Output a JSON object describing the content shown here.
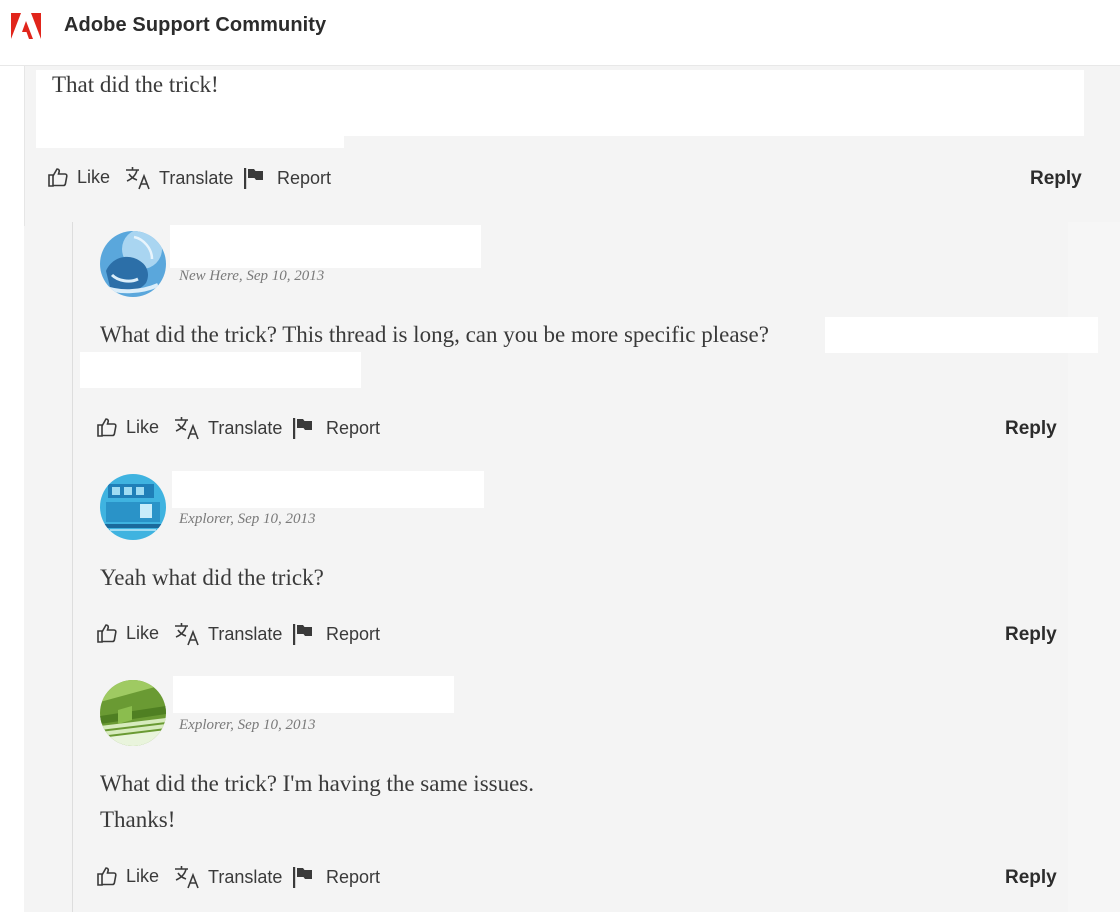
{
  "header": {
    "title": "Adobe Support Community",
    "logo_icon": "adobe-logo-icon",
    "brand_color": "#e1251b"
  },
  "actions": {
    "like": "Like",
    "translate": "Translate",
    "report": "Report",
    "reply": "Reply"
  },
  "posts": [
    {
      "body_lines": [
        "That did the trick!"
      ]
    },
    {
      "meta": "New Here, Sep 10, 2013",
      "body_lines": [
        "What did the trick?  This thread is long, can you be more specific please?"
      ]
    },
    {
      "meta": "Explorer, Sep 10, 2013",
      "body_lines": [
        "Yeah what did the trick?"
      ]
    },
    {
      "meta": "Explorer, Sep 10, 2013",
      "body_lines": [
        "What did the trick? I'm having the same issues.",
        "Thanks!"
      ]
    }
  ]
}
